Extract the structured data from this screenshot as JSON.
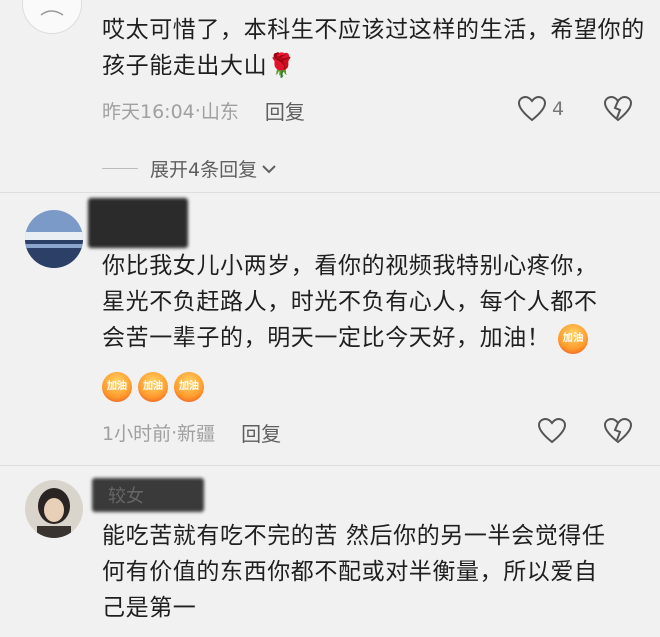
{
  "comments": [
    {
      "text": "哎太可惜了，本科生不应该过这样的生活，希望你的孩子能走出大山",
      "emoji": "🌹",
      "time": "昨天16:04",
      "location": "山东",
      "reply_label": "回复",
      "likes": "4"
    },
    {
      "text_line1": "你比我女儿小两岁，看你的视频我特别心疼你，",
      "text_line2": "星光不负赶路人，时光不负有心人，每个人都不",
      "text_line3": "会苦一辈子的，明天一定比今天好，加油！",
      "emoji_label": "加油",
      "time": "1小时前",
      "location": "新疆",
      "reply_label": "回复"
    },
    {
      "username_partial": "较女",
      "text_line1": "能吃苦就有吃不完的苦 然后你的另一半会觉得任",
      "text_line2": "何有价值的东西你都不配或对半衡量，所以爱自",
      "text_line3": "己是第一"
    }
  ],
  "expand_replies": "展开4条回复",
  "icons": {
    "like": "heart-outline-icon",
    "dislike": "broken-heart-icon",
    "expand": "chevron-down-icon"
  },
  "colors": {
    "background": "#f1f1f1",
    "meta": "#a0a0a0",
    "text": "#1f1f1f"
  }
}
